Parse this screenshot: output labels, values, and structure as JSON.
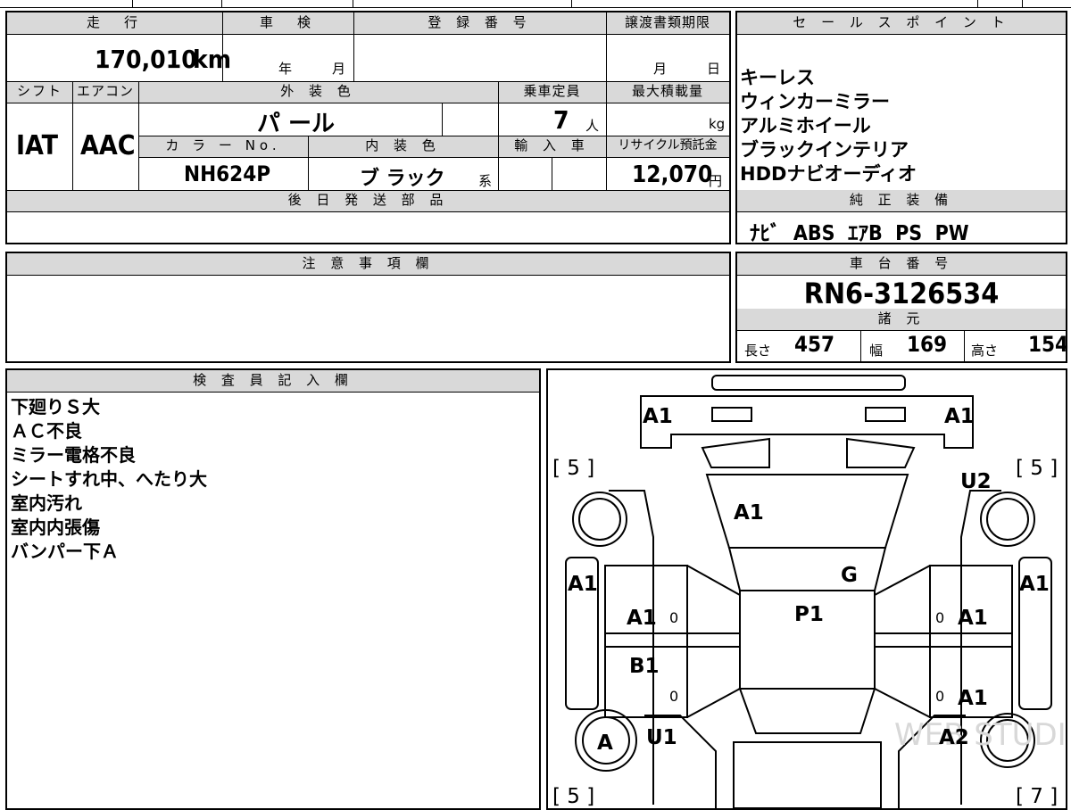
{
  "vehicle": {
    "mileage_header": "走　行",
    "mileage_value": "170,010",
    "mileage_unit": "km",
    "inspection_header": "車　検",
    "inspection_year": "年",
    "inspection_month": "月",
    "registration_header": "登 録 番 号",
    "transfer_header": "譲渡書類期限",
    "transfer_month": "月",
    "transfer_day": "日",
    "shift_header": "シフト",
    "aircon_header": "エアコン",
    "exterior_header": "外 装 色",
    "capacity_header": "乗車定員",
    "maxload_header": "最大積載量",
    "shift_value": "IAT",
    "aircon_value": "AAC",
    "exterior_value": "パ ール",
    "capacity_value": "7",
    "capacity_unit": "人",
    "maxload_unit": "kg",
    "color_no_header": "カ ラ ー No.",
    "interior_header": "内 装 色",
    "import_header": "輸 入 車",
    "recycle_header": "リサイクル預託金",
    "color_no_value": "NH624P",
    "interior_value": "ブ ラック",
    "interior_suffix": "系",
    "recycle_value": "12,070",
    "recycle_unit": "円",
    "later_parts_header": "後 日 発 送 部 品"
  },
  "sales": {
    "header": "セ ー ル ス ポ イ ン ト",
    "points": [
      "キーレス",
      "ウィンカーミラー",
      "アルミホイール",
      "ブラックインテリア",
      "HDDナビオーディオ"
    ],
    "equipment_header": "純 正 装 備",
    "equipment": "ﾅﾋﾞ  ABS  ｴｱB  PS  PW"
  },
  "notes": {
    "header": "注 意 事 項 欄"
  },
  "chassis": {
    "header": "車 台 番 号",
    "number": "RN6-3126534",
    "specs_header": "諸 元",
    "length_label": "長さ",
    "length_value": "457",
    "width_label": "幅",
    "width_value": "169",
    "height_label": "高さ",
    "height_value": "154"
  },
  "inspector": {
    "header": "検 査 員 記 入 欄",
    "lines": [
      "下廻りＳ大",
      "ＡＣ不良",
      "ミラー電格不良",
      "シートすれ中、へたり大",
      "室内汚れ",
      "室内内張傷",
      "バンパー下Ａ"
    ]
  },
  "diagram": {
    "front_left": "A1",
    "front_right": "A1",
    "tread_fl": "[ 5 ]",
    "tread_fr": "[ 5 ]",
    "tread_rl": "[ 5 ]",
    "tread_rr": "[ 7 ]",
    "right_front_wheel": "U2",
    "windshield": "A1",
    "bonnet_right": "G",
    "roof": "P1",
    "left_front_fender": "A1",
    "right_front_fender": "A1",
    "left_front_door": "A1",
    "right_front_door": "A1",
    "left_rear_door": "B1",
    "right_rear_door": "A1",
    "left_rear_wheel": "A",
    "left_rear_quarter": "U1",
    "right_rear_quarter": "A2",
    "zero_1": "0",
    "zero_2": "0",
    "zero_3": "0",
    "zero_4": "0",
    "watermark": "WEB STUDIO"
  }
}
